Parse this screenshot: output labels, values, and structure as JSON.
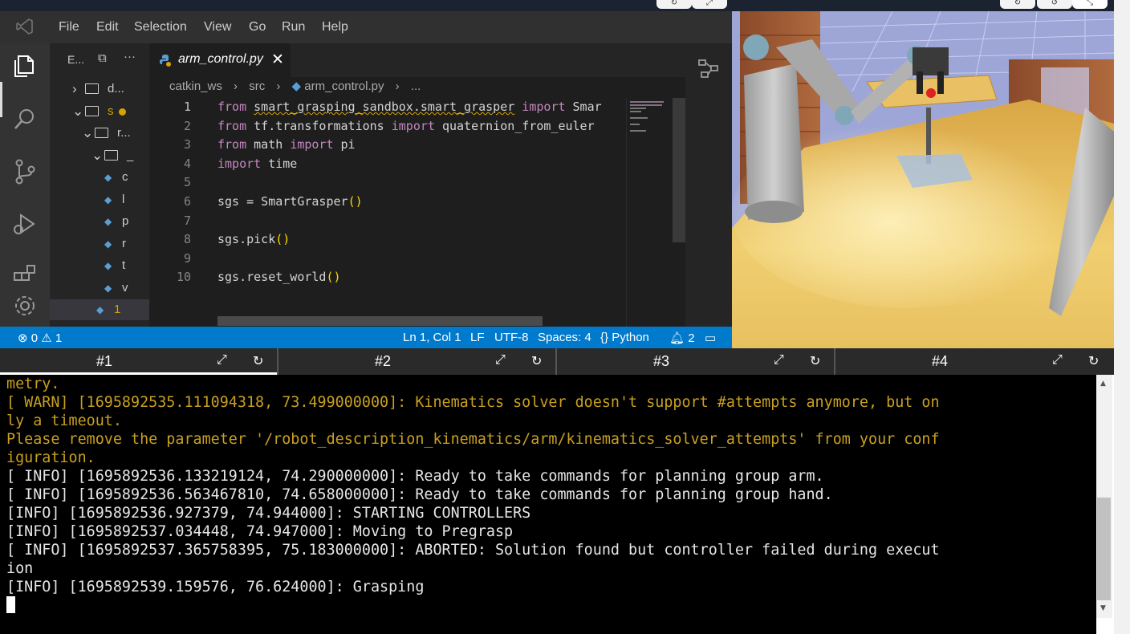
{
  "menubar": {
    "items": [
      "File",
      "Edit",
      "Selection",
      "View",
      "Go",
      "Run",
      "Help"
    ]
  },
  "explorer": {
    "header": "E...",
    "rows": [
      {
        "label": "d...",
        "type": "folder-collapsed"
      },
      {
        "label": "s",
        "type": "folder-open",
        "modified": true
      },
      {
        "label": "r...",
        "type": "folder-open"
      },
      {
        "label": "_",
        "type": "folder-open"
      },
      {
        "label": "c",
        "type": "python-file"
      },
      {
        "label": "l",
        "type": "python-file"
      },
      {
        "label": "p",
        "type": "python-file"
      },
      {
        "label": "r",
        "type": "python-file"
      },
      {
        "label": "t",
        "type": "python-file"
      },
      {
        "label": "v",
        "type": "python-file"
      },
      {
        "label": "1",
        "type": "python-file"
      }
    ]
  },
  "editor": {
    "tab_label": "arm_control.py",
    "breadcrumb": [
      "catkin_ws",
      "src",
      "arm_control.py",
      "..."
    ],
    "code_lines": [
      {
        "n": "1",
        "parts": [
          [
            "kw",
            "from"
          ],
          [
            "t",
            " "
          ],
          [
            "sq",
            "smart_grasping_sandbox.smart_grasper"
          ],
          [
            "t",
            " "
          ],
          [
            "kw",
            "import"
          ],
          [
            "t",
            " Smar"
          ]
        ]
      },
      {
        "n": "2",
        "parts": [
          [
            "kw",
            "from"
          ],
          [
            "t",
            " tf.transformations "
          ],
          [
            "kw",
            "import"
          ],
          [
            "t",
            " quaternion_from_euler"
          ]
        ]
      },
      {
        "n": "3",
        "parts": [
          [
            "kw",
            "from"
          ],
          [
            "t",
            " math "
          ],
          [
            "kw",
            "import"
          ],
          [
            "t",
            " pi"
          ]
        ]
      },
      {
        "n": "4",
        "parts": [
          [
            "kw",
            "import"
          ],
          [
            "t",
            " time"
          ]
        ]
      },
      {
        "n": "5",
        "parts": []
      },
      {
        "n": "6",
        "parts": [
          [
            "t",
            "sgs = SmartGrasper"
          ],
          [
            "p",
            "()"
          ]
        ]
      },
      {
        "n": "7",
        "parts": []
      },
      {
        "n": "8",
        "parts": [
          [
            "t",
            "sgs.pick"
          ],
          [
            "p",
            "()"
          ]
        ]
      },
      {
        "n": "9",
        "parts": []
      },
      {
        "n": "10",
        "parts": [
          [
            "t",
            "sgs.reset_world"
          ],
          [
            "p",
            "()"
          ]
        ]
      }
    ]
  },
  "statusbar": {
    "errors": "0",
    "warnings": "1",
    "position": "Ln 1, Col 1",
    "eol": "LF",
    "encoding": "UTF-8",
    "spaces": "Spaces: 4",
    "language": "Python",
    "notifications": "2"
  },
  "terminal_tabs": [
    "#1",
    "#2",
    "#3",
    "#4"
  ],
  "terminal": {
    "lines": [
      {
        "cls": "warn",
        "text": "metry."
      },
      {
        "cls": "warn",
        "text": "[ WARN] [1695892535.111094318, 73.499000000]: Kinematics solver doesn't support #attempts anymore, but on"
      },
      {
        "cls": "warn",
        "text": "ly a timeout."
      },
      {
        "cls": "warn",
        "text": "Please remove the parameter '/robot_description_kinematics/arm/kinematics_solver_attempts' from your conf"
      },
      {
        "cls": "warn",
        "text": "iguration."
      },
      {
        "cls": "info",
        "text": "[ INFO] [1695892536.133219124, 74.290000000]: Ready to take commands for planning group arm."
      },
      {
        "cls": "info",
        "text": "[ INFO] [1695892536.563467810, 74.658000000]: Ready to take commands for planning group hand."
      },
      {
        "cls": "info",
        "text": "[INFO] [1695892536.927379, 74.944000]: STARTING CONTROLLERS"
      },
      {
        "cls": "info",
        "text": "[INFO] [1695892537.034448, 74.947000]: Moving to Pregrasp"
      },
      {
        "cls": "info",
        "text": "[ INFO] [1695892537.365758395, 75.183000000]: ABORTED: Solution found but controller failed during execut"
      },
      {
        "cls": "info",
        "text": "ion"
      },
      {
        "cls": "info",
        "text": "[INFO] [1695892539.159576, 76.624000]: Grasping"
      }
    ]
  },
  "colors": {
    "statusbar": "#007acc",
    "warn": "#c8a020",
    "keyword": "#c586c0",
    "paren": "#ffd700"
  }
}
